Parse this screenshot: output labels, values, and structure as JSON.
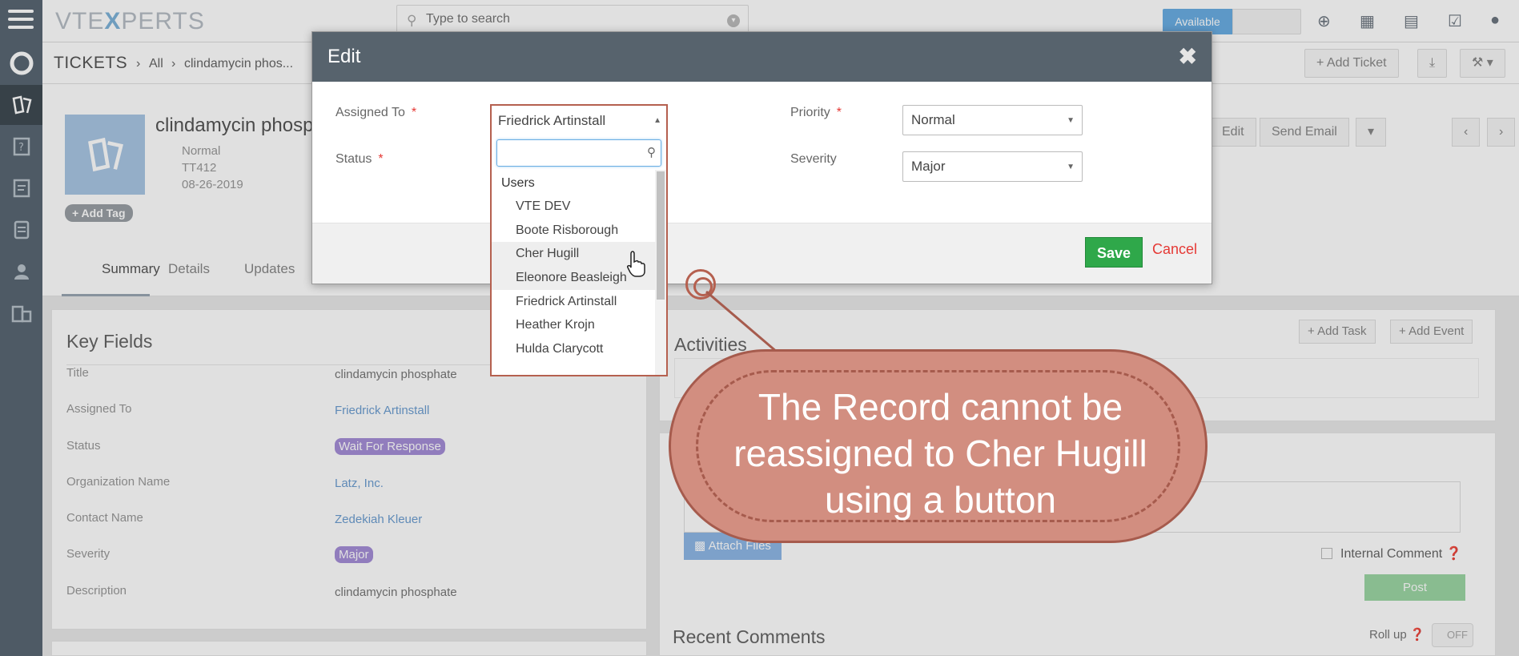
{
  "app": {
    "brand_pre": "VTE",
    "brand_x": "X",
    "brand_post": "PERTS",
    "search_placeholder": "Type to search",
    "status_label": "Available"
  },
  "breadcrumb": {
    "module": "TICKETS",
    "list": "All",
    "record": "clindamycin phos..."
  },
  "header_buttons": {
    "add_ticket": "Add Ticket"
  },
  "record": {
    "title": "clindamycin phosp",
    "priority": "Normal",
    "number": "TT412",
    "date": "08-26-2019",
    "add_tag": "Add Tag",
    "edit_label": "Edit",
    "send_email_label": "Send Email"
  },
  "tabs": [
    "Summary",
    "Details",
    "Updates"
  ],
  "key_fields": {
    "title": "Key Fields",
    "rows": [
      {
        "label": "Title",
        "value": "clindamycin phosphate"
      },
      {
        "label": "Assigned To",
        "value": "Friedrick Artinstall"
      },
      {
        "label": "Status",
        "value": "Wait For Response"
      },
      {
        "label": "Organization Name",
        "value": "Latz, Inc."
      },
      {
        "label": "Contact Name",
        "value": "Zedekiah Kleuer"
      },
      {
        "label": "Severity",
        "value": "Major"
      },
      {
        "label": "Description",
        "value": "clindamycin phosphate"
      }
    ]
  },
  "activities": {
    "title": "Activities",
    "add_task": "Add Task",
    "add_event": "Add Event"
  },
  "comments": {
    "attach": "Attach Files",
    "internal": "Internal Comment",
    "post": "Post",
    "recent": "Recent Comments",
    "rollup": "Roll up",
    "off": "OFF"
  },
  "modal": {
    "title": "Edit",
    "assigned_label": "Assigned To",
    "status_label": "Status",
    "priority_label": "Priority",
    "severity_label": "Severity",
    "priority_value": "Normal",
    "severity_value": "Major",
    "save": "Save",
    "cancel": "Cancel"
  },
  "dropdown": {
    "selected": "Friedrick Artinstall",
    "group": "Users",
    "items": [
      "VTE DEV",
      "Boote Risborough",
      "Cher Hugill",
      "Eleonore Beasleigh",
      "Friedrick Artinstall",
      "Heather Krojn",
      "Hulda Clarycott"
    ]
  },
  "callout": {
    "line1": "The Record cannot be",
    "line2": "reassigned to Cher Hugill",
    "line3": "using a button"
  }
}
